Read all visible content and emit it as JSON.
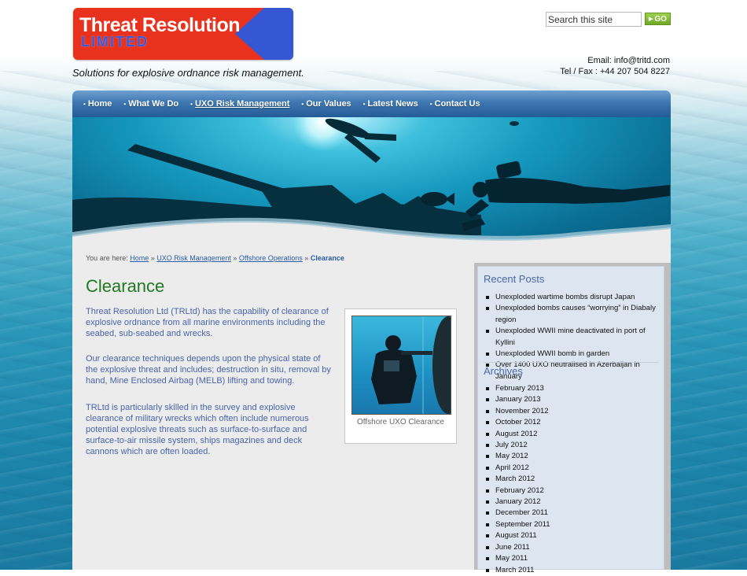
{
  "header": {
    "logo_title": "Threat Resolution",
    "logo_subtitle": "LIMITED",
    "tagline": "Solutions for explosive ordnance risk management.",
    "search_placeholder": "Search this site",
    "search_button": "GO",
    "contact_email": "Email: info@tritd.com",
    "contact_phone": "Tel / Fax : +44 207 504 8227"
  },
  "colors": {
    "logo_red": "#e8321e",
    "logo_blue": "#3c58d6",
    "nav_blue": "#3d76b0",
    "title_green": "#1f7a22",
    "body_text_blue": "#4a64a8",
    "search_green": "#7cb52f"
  },
  "nav": {
    "items": [
      {
        "label": "Home"
      },
      {
        "label": "What We Do"
      },
      {
        "label": "UXO Risk Management",
        "active": true
      },
      {
        "label": "Our Values"
      },
      {
        "label": "Latest News"
      },
      {
        "label": "Contact Us"
      }
    ]
  },
  "breadcrumb": {
    "prefix": "You are here:",
    "links": [
      "Home",
      "UXO Risk Management",
      "Offshore Operations"
    ],
    "separator": "»",
    "current": "Clearance"
  },
  "main": {
    "title": "Clearance",
    "paragraphs": [
      "Threat Resolution Ltd (TRLtd) has the capability of clearance of explosive ordnance from all marine environments including the seabed, sub-seabed and wrecks.",
      "Our clearance techniques depends upon the physical state of the explosive threat and includes; destruction in situ, removal by hand, Mine Enclosed Airbag (MELB) lifting and towing.",
      "TRLtd is particularly skilled in the survey and explosive clearance of military wrecks which often include numerous potential explosive threats such as surface-to-surface and surface-to-air missile system, ships magazines and deck cannons which are often loaded."
    ],
    "figure_caption": "Offshore UXO Clearance"
  },
  "sidebar": {
    "recent_heading": "Recent Posts",
    "recent_posts": [
      "Unexploded wartime bombs disrupt Japan",
      "Unexploded bombs causes “worrying” in Diabaly region",
      "Unexploded WWII mine deactivated in port of Kyllini",
      "Unexploded WWII bomb in garden",
      "Over 1400 UXO neutralised in Azerbaijan in January"
    ],
    "archives_heading": "Archives",
    "archives": [
      "February 2013",
      "January 2013",
      "November 2012",
      "October 2012",
      "August 2012",
      "July 2012",
      "May 2012",
      "April 2012",
      "March 2012",
      "February 2012",
      "January 2012",
      "December 2011",
      "September 2011",
      "August 2011",
      "June 2011",
      "May 2011",
      "March 2011"
    ]
  }
}
